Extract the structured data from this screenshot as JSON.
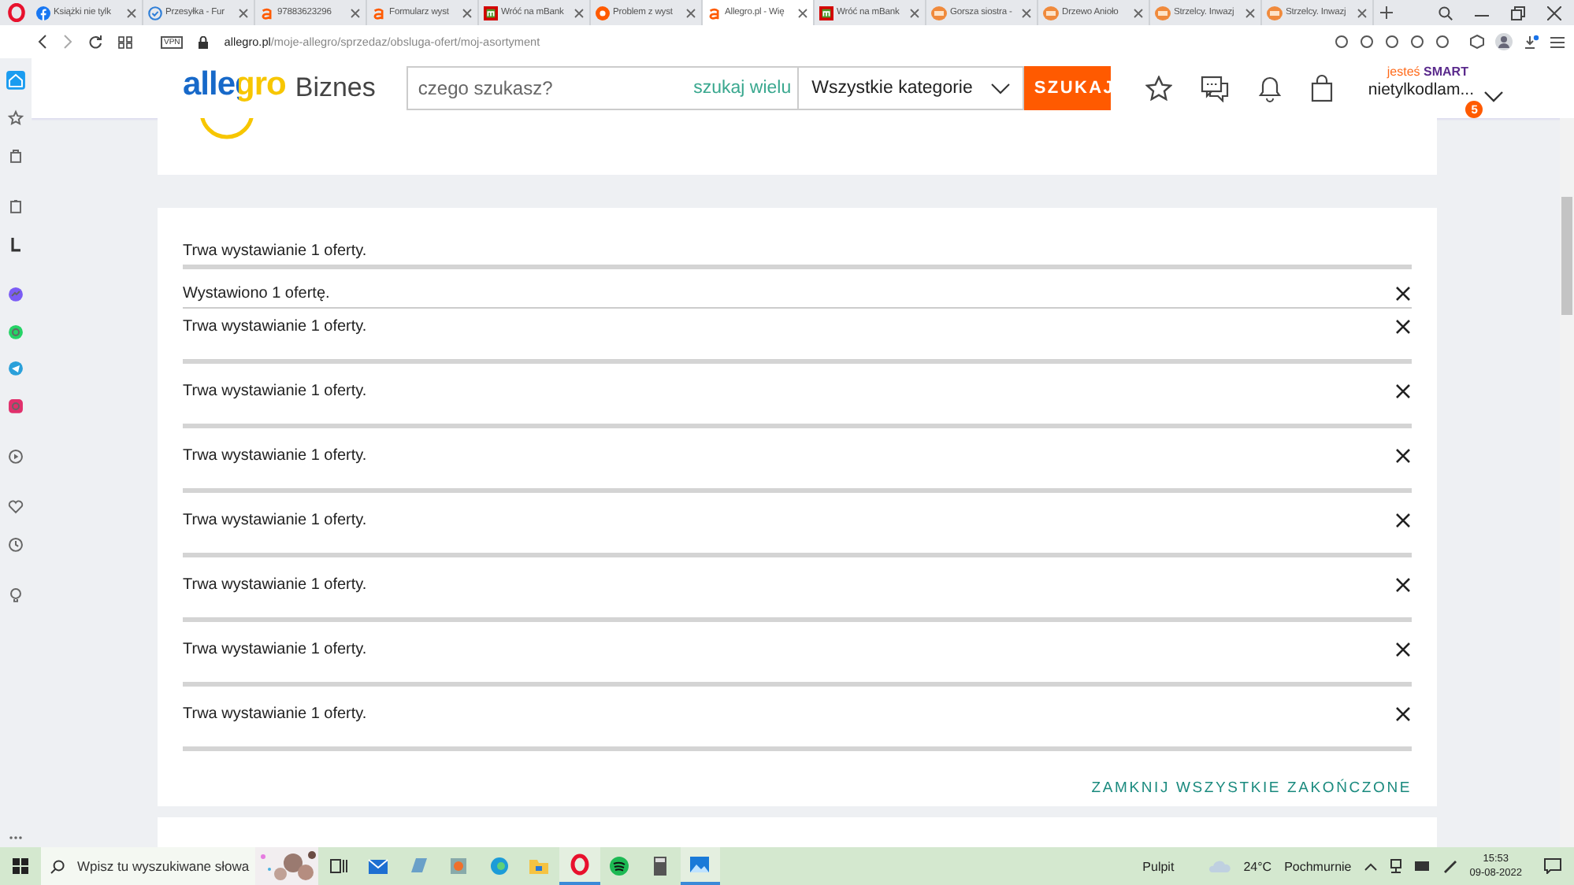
{
  "browser": {
    "tabs": [
      {
        "title": "Książki nie tylk",
        "selected": false
      },
      {
        "title": "Przesyłka - Fur",
        "selected": false
      },
      {
        "title": "97883623296",
        "selected": false
      },
      {
        "title": "Formularz wyst",
        "selected": false
      },
      {
        "title": "Wróć na mBank",
        "selected": false
      },
      {
        "title": "Problem z wyst",
        "selected": false
      },
      {
        "title": "Allegro.pl - Wię",
        "selected": true
      },
      {
        "title": "Wróć na mBank",
        "selected": false
      },
      {
        "title": "Gorsza siostra -",
        "selected": false
      },
      {
        "title": "Drzewo Anioło",
        "selected": false
      },
      {
        "title": "Strzelcy. Inwazj",
        "selected": false
      },
      {
        "title": "Strzelcy. Inwazj",
        "selected": false
      }
    ],
    "address": {
      "host": "allegro.pl",
      "path": "/moje-allegro/sprzedaz/obsluga-ofert/moj-asortyment",
      "vpn": "VPN"
    },
    "sidebar": [
      {
        "selected": true
      },
      {
        "selected": false
      },
      {
        "selected": false
      },
      {
        "selected": false
      },
      {
        "selected": false
      },
      {
        "selected": false
      },
      {
        "selected": false
      },
      {
        "selected": false
      },
      {
        "selected": false
      },
      {
        "selected": false
      },
      {
        "selected": false
      },
      {
        "selected": false
      },
      {
        "selected": false
      },
      {
        "selected": false
      }
    ]
  },
  "header": {
    "logo": "allegro",
    "logo_suffix": "Biznes",
    "search_placeholder": "czego szukasz?",
    "search_many": "szukaj wielu",
    "category": "Wszystkie kategorie",
    "search_button": "SZUKAJ",
    "smart_prefix": "jesteś",
    "smart_label": "SMART",
    "user": "nietylkodlam...",
    "badge": "5"
  },
  "offers": {
    "rows": [
      {
        "text": "Trwa wystawianie 1 oferty.",
        "kind": "pending",
        "closable": false,
        "level": 1
      },
      {
        "text": "Wystawiono 1 ofertę.",
        "kind": "done",
        "closable": true
      },
      {
        "text": "Trwa wystawianie 1 oferty.",
        "kind": "pending",
        "closable": true,
        "level": 1
      },
      {
        "text": "Trwa wystawianie 1 oferty.",
        "kind": "pending",
        "closable": true,
        "level": 1
      },
      {
        "text": "Trwa wystawianie 1 oferty.",
        "kind": "pending",
        "closable": true,
        "level": 1
      },
      {
        "text": "Trwa wystawianie 1 oferty.",
        "kind": "pending",
        "closable": true,
        "level": 1
      },
      {
        "text": "Trwa wystawianie 1 oferty.",
        "kind": "pending",
        "closable": true,
        "level": 1
      },
      {
        "text": "Trwa wystawianie 1 oferty.",
        "kind": "pending",
        "closable": true,
        "level": 1
      },
      {
        "text": "Trwa wystawianie 1 oferty.",
        "kind": "pending",
        "closable": true,
        "level": 1
      }
    ],
    "close_all": "ZAMKNIJ WSZYSTKIE ZAKOŃCZONE"
  },
  "taskbar": {
    "search_placeholder": "Wpisz tu wyszukiwane słowa",
    "apps": [
      {
        "selected": false
      },
      {
        "selected": false
      },
      {
        "selected": false
      },
      {
        "selected": false
      },
      {
        "selected": false
      },
      {
        "selected": true
      },
      {
        "selected": false
      },
      {
        "selected": false
      },
      {
        "selected": true
      }
    ],
    "desktop": "Pulpit",
    "temperature": "24°C",
    "weather": "Pochmurnie",
    "time": "15:53",
    "date": "09-08-2022"
  }
}
